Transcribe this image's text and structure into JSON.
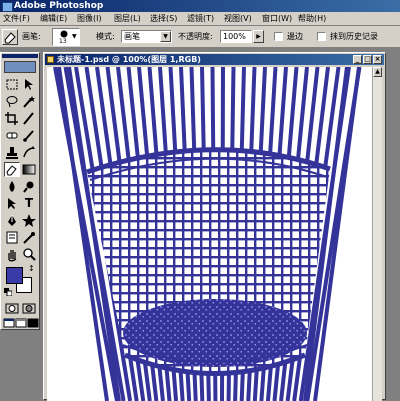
{
  "app": {
    "title": "Adobe Photoshop"
  },
  "menu": [
    {
      "label": "文件(F)"
    },
    {
      "label": "编辑(E)"
    },
    {
      "label": "图像(I)"
    },
    {
      "label": "图层(L)"
    },
    {
      "label": "选择(S)"
    },
    {
      "label": "滤镜(T)"
    },
    {
      "label": "视图(V)"
    },
    {
      "label": "窗口(W)"
    },
    {
      "label": "帮助(H)"
    }
  ],
  "options": {
    "brush_label": "画笔:",
    "brush_size": "13",
    "mode_label": "模式:",
    "mode_value": "画笔",
    "opacity_label": "不透明度:",
    "opacity_value": "100%",
    "edge_label": "邊边",
    "history_label": "抹到历史记录"
  },
  "toolbox": {
    "colors": {
      "foreground": "#3a3aa8",
      "background": "#ffffff"
    }
  },
  "document": {
    "title": "未标题-1.psd @ 100%(图层 1,RGB)"
  },
  "artwork": {
    "stroke_color": "#33339a",
    "background": "#ffffff"
  }
}
